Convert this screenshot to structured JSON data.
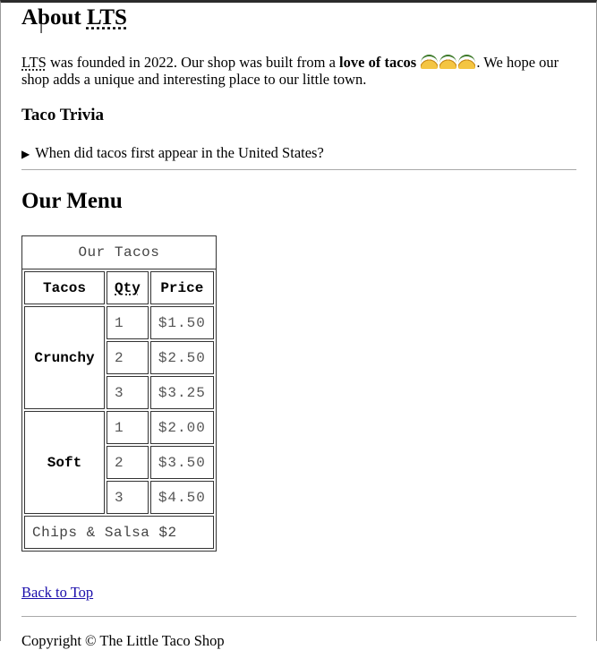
{
  "about": {
    "heading_prefix": "About ",
    "heading_abbr": "LTS",
    "intro_abbr": "LTS",
    "intro_text_1": " was founded in 2022. Our shop was built from a ",
    "intro_bold": "love of tacos",
    "intro_text_2": ". We hope our shop adds a unique and interesting place to our little town.",
    "emoji_icons": [
      "taco-icon",
      "taco-icon",
      "taco-icon"
    ]
  },
  "trivia": {
    "heading": "Taco Trivia",
    "summary_marker": "▶",
    "summary": "When did tacos first appear in the United States?"
  },
  "menu": {
    "heading": "Our Menu",
    "caption": "Our Tacos",
    "headers": [
      "Tacos",
      "Qty",
      "Price"
    ],
    "groups": [
      {
        "name": "Crunchy",
        "rows": [
          {
            "qty": "1",
            "price": "$1.50"
          },
          {
            "qty": "2",
            "price": "$2.50"
          },
          {
            "qty": "3",
            "price": "$3.25"
          }
        ]
      },
      {
        "name": "Soft",
        "rows": [
          {
            "qty": "1",
            "price": "$2.00"
          },
          {
            "qty": "2",
            "price": "$3.50"
          },
          {
            "qty": "3",
            "price": "$4.50"
          }
        ]
      }
    ],
    "footer": "Chips & Salsa $2"
  },
  "nav": {
    "back_to_top": "Back to Top"
  },
  "footer": {
    "copyright": "Copyright © The Little Taco Shop"
  },
  "colors": {
    "link": "#1a0dab",
    "rule": "#a9a9a9"
  }
}
